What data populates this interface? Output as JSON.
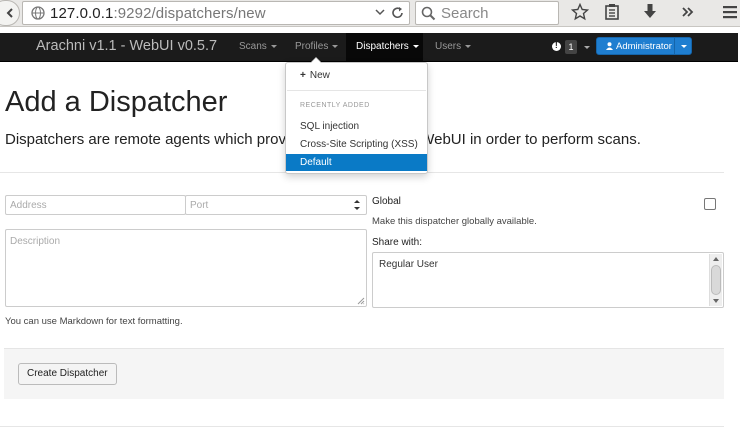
{
  "browser": {
    "url_host": "127.0.0.1",
    "url_rest": ":9292/dispatchers/new",
    "search_placeholder": "Search"
  },
  "navbar": {
    "brand": "Arachni v1.1 - WebUI v0.5.7",
    "items": [
      {
        "label": "Scans"
      },
      {
        "label": "Profiles"
      },
      {
        "label": "Dispatchers"
      },
      {
        "label": "Users"
      }
    ],
    "notification_count": "1",
    "user_button": "Administrator"
  },
  "dropdown": {
    "new_label": "New",
    "header": "RECENTLY ADDED",
    "items": [
      {
        "label": "SQL injection"
      },
      {
        "label": "Cross-Site Scripting (XSS)"
      },
      {
        "label": "Default"
      }
    ]
  },
  "page": {
    "title": "Add a Dispatcher",
    "description": "Dispatchers are remote agents which provide Instances to the WebUI in order to perform scans."
  },
  "form": {
    "address_placeholder": "Address",
    "port_placeholder": "Port",
    "description_placeholder": "Description",
    "markdown_help": "You can use Markdown for text formatting.",
    "global_label": "Global",
    "global_help": "Make this dispatcher globally available.",
    "share_label": "Share with:",
    "share_options": [
      {
        "label": "Regular User"
      }
    ],
    "submit_label": "Create Dispatcher"
  },
  "colors": {
    "navbar_bg": "#1b1b1b",
    "primary": "#1f7ed0",
    "menu_highlight": "#0a7ac6"
  }
}
